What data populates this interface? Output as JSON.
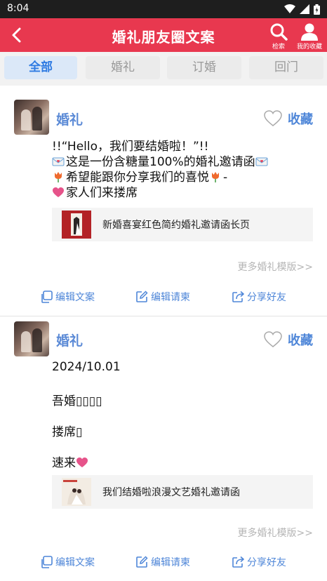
{
  "status": {
    "time": "8:04"
  },
  "header": {
    "title": "婚礼朋友圈文案",
    "search_label": "检索",
    "favorites_label": "我的收藏"
  },
  "tabs": [
    {
      "label": "全部",
      "active": true
    },
    {
      "label": "婚礼",
      "active": false
    },
    {
      "label": "订婚",
      "active": false
    },
    {
      "label": "回门",
      "active": false
    }
  ],
  "posts": [
    {
      "author": "婚礼",
      "collect_label": "收藏",
      "lines": [
        "!!“Hello，我们要结婚啦！”!!",
        "这是一份含糖量100%的婚礼邀请函",
        "希望能跟你分享我们的喜悦",
        "家人们来搂席"
      ],
      "line3_suffix": "-",
      "template_title": "新婚喜宴红色简约婚礼邀请函长页",
      "more_label": "更多婚礼模版>>",
      "actions": [
        "编辑文案",
        "编辑请柬",
        "分享好友"
      ]
    },
    {
      "author": "婚礼",
      "collect_label": "收藏",
      "lines": [
        "2024/10.01",
        "吾婚▯▯▯▯",
        "搂席▯",
        "速来"
      ],
      "template_title": "我们结婚啦浪漫文艺婚礼邀请函",
      "more_label": "更多婚礼模版>>",
      "actions": [
        "编辑文案",
        "编辑请柬",
        "分享好友"
      ]
    }
  ],
  "colors": {
    "accent": "#e8384f",
    "link": "#4e86d8",
    "tab_active": "#2f7be2"
  }
}
